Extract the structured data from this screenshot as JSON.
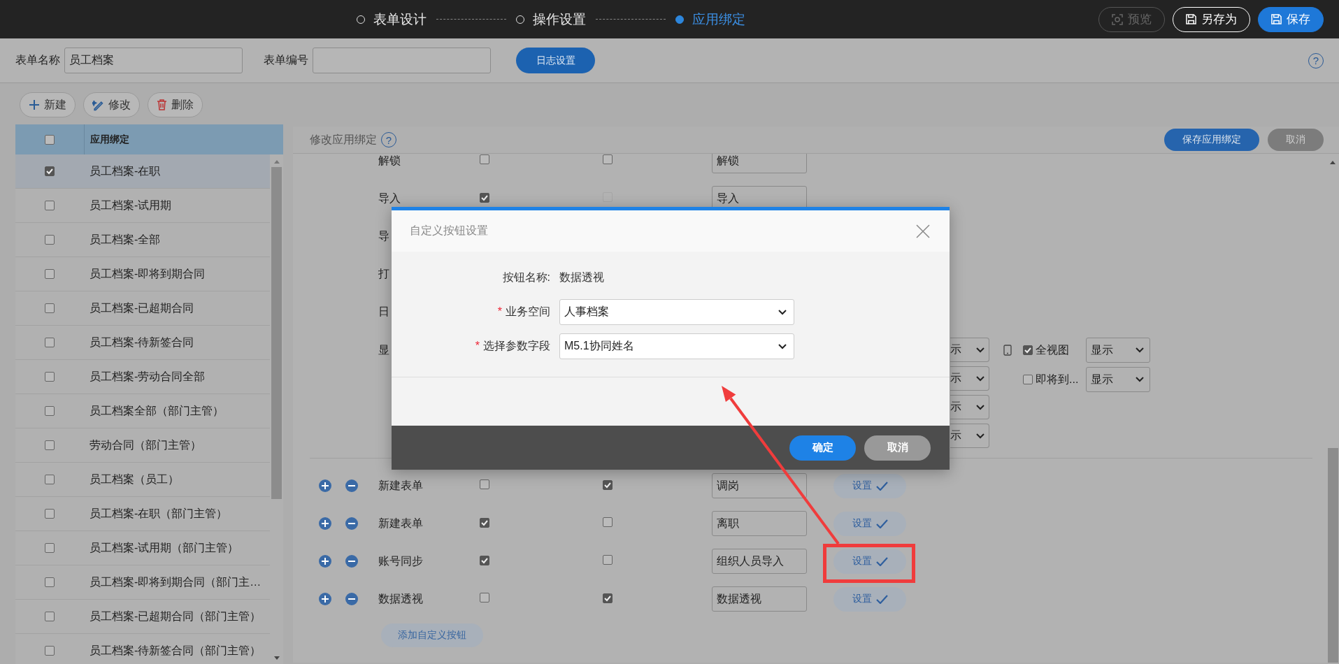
{
  "top_bar": {
    "steps": [
      {
        "label": "表单设计",
        "selected": false
      },
      {
        "label": "操作设置",
        "selected": false
      },
      {
        "label": "应用绑定",
        "selected": true
      }
    ],
    "buttons": [
      {
        "label": "预览",
        "kind": "disabled"
      },
      {
        "label": "另存为",
        "kind": "outline"
      },
      {
        "label": "保存",
        "kind": "primary"
      }
    ]
  },
  "form_header": {
    "fields": [
      {
        "label": "表单名称",
        "value": "员工档案"
      },
      {
        "label": "表单编号"
      }
    ],
    "log_button": "日志设置",
    "help": "?"
  },
  "toolbar": [
    {
      "label": "新建",
      "kind": "add"
    },
    {
      "label": "修改",
      "kind": "edit"
    },
    {
      "label": "删除",
      "kind": "delete"
    }
  ],
  "binding_list": {
    "header": {
      "label": "应用绑定",
      "checked": false
    },
    "rows": [
      {
        "label": "员工档案-在职",
        "checked": true,
        "selected": true
      },
      {
        "label": "员工档案-试用期",
        "checked": false,
        "selected": false
      },
      {
        "label": "员工档案-全部",
        "checked": false,
        "selected": false
      },
      {
        "label": "员工档案-即将到期合同",
        "checked": false,
        "selected": false
      },
      {
        "label": "员工档案-已超期合同",
        "checked": false,
        "selected": false
      },
      {
        "label": "员工档案-待新签合同",
        "checked": false,
        "selected": false
      },
      {
        "label": "员工档案-劳动合同全部",
        "checked": false,
        "selected": false
      },
      {
        "label": "员工档案全部（部门主管）",
        "checked": false,
        "selected": false
      },
      {
        "label": "劳动合同（部门主管）",
        "checked": false,
        "selected": false
      },
      {
        "label": "员工档案（员工）",
        "checked": false,
        "selected": false
      },
      {
        "label": "员工档案-在职（部门主管）",
        "checked": false,
        "selected": false
      },
      {
        "label": "员工档案-试用期（部门主管）",
        "checked": false,
        "selected": false
      },
      {
        "label": "员工档案-即将到期合同（部门主…",
        "checked": false,
        "selected": false
      },
      {
        "label": "员工档案-已超期合同（部门主管）",
        "checked": false,
        "selected": false
      },
      {
        "label": "员工档案-待新签合同（部门主管）",
        "checked": false,
        "selected": false
      }
    ]
  },
  "panel": {
    "title": "修改应用绑定",
    "help": "?",
    "buttons": [
      {
        "label": "保存应用绑定",
        "kind": "primary"
      },
      {
        "label": "取消",
        "kind": "secondary"
      }
    ],
    "operation_rows": [
      {
        "label": "解锁",
        "checked_1": false,
        "checked_2": false,
        "disabled_2": false,
        "name": "解锁"
      },
      {
        "label": "导入",
        "checked_1": true,
        "checked_2": false,
        "disabled_2": true,
        "name": "导入"
      },
      {
        "label": "导"
      },
      {
        "label": "打"
      },
      {
        "label": "日"
      }
    ],
    "display_row": {
      "label": "显",
      "covered_selects": [
        "示",
        "示",
        "示",
        "示"
      ],
      "options": [
        {
          "label": "全视图",
          "checked": true,
          "value": "显示",
          "device_icon": true
        },
        {
          "label": "即将到...",
          "checked": false,
          "value": "显示",
          "device_icon": false
        }
      ]
    },
    "custom_buttons": [
      {
        "label": "新建表单",
        "checked_1": false,
        "checked_2": true,
        "name": "调岗",
        "button": "设置",
        "highlighted": false
      },
      {
        "label": "新建表单",
        "checked_1": true,
        "checked_2": false,
        "name": "离职",
        "button": "设置",
        "highlighted": false
      },
      {
        "label": "账号同步",
        "checked_1": true,
        "checked_2": false,
        "name": "组织人员导入",
        "button": "设置",
        "highlighted": true
      },
      {
        "label": "数据透视",
        "checked_1": false,
        "checked_2": true,
        "name": "数据透视",
        "button": "设置",
        "highlighted": false
      }
    ],
    "add_button": "添加自定义按钮"
  },
  "dialog": {
    "title": "自定义按钮设置",
    "fields": [
      {
        "kind": "text",
        "label": "按钮名称:",
        "value": "数据透视"
      },
      {
        "kind": "select",
        "required_mark": "*",
        "label": "业务空间",
        "value": "人事档案"
      },
      {
        "kind": "select",
        "required_mark": "*",
        "label": "选择参数字段",
        "value": "M5.1协同姓名"
      }
    ],
    "buttons": [
      {
        "label": "确定",
        "kind": "primary"
      },
      {
        "label": "取消",
        "kind": "secondary"
      }
    ]
  }
}
